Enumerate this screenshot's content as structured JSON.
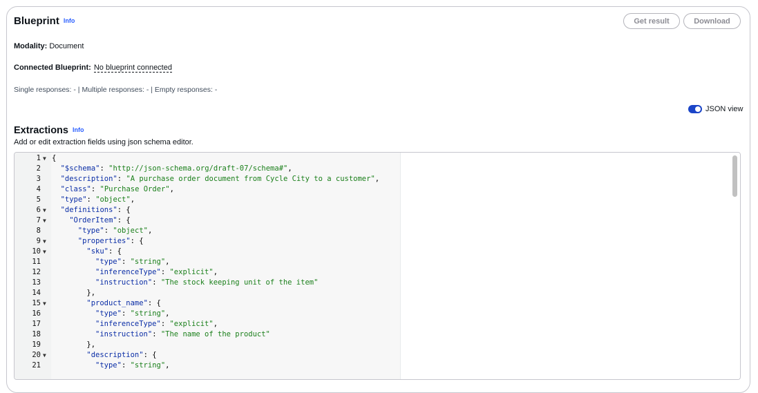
{
  "header": {
    "title": "Blueprint",
    "info_label": "Info",
    "get_result_label": "Get result",
    "download_label": "Download"
  },
  "modality": {
    "label": "Modality:",
    "value": "Document"
  },
  "connected": {
    "label": "Connected Blueprint:",
    "value": "No blueprint connected"
  },
  "responses": {
    "text": "Single responses: - | Multiple responses: - | Empty responses: -"
  },
  "json_toggle": {
    "label": "JSON view",
    "on": true
  },
  "extractions": {
    "title": "Extractions",
    "info_label": "Info",
    "description": "Add or edit extraction fields using json schema editor."
  },
  "colors": {
    "accent": "#1b45c8",
    "key": "#0a2da6",
    "string": "#1a7f1a"
  },
  "editor": {
    "lines": [
      {
        "n": "1",
        "fold": true,
        "indent": 0,
        "tokens": [
          {
            "t": "p",
            "v": "{"
          }
        ]
      },
      {
        "n": "2",
        "fold": false,
        "indent": 1,
        "tokens": [
          {
            "t": "k",
            "v": "\"$schema\""
          },
          {
            "t": "p",
            "v": ": "
          },
          {
            "t": "s",
            "v": "\"http://json-schema.org/draft-07/schema#\""
          },
          {
            "t": "p",
            "v": ","
          }
        ]
      },
      {
        "n": "3",
        "fold": false,
        "indent": 1,
        "tokens": [
          {
            "t": "k",
            "v": "\"description\""
          },
          {
            "t": "p",
            "v": ": "
          },
          {
            "t": "s",
            "v": "\"A purchase order document from Cycle City to a customer\""
          },
          {
            "t": "p",
            "v": ","
          }
        ]
      },
      {
        "n": "4",
        "fold": false,
        "indent": 1,
        "tokens": [
          {
            "t": "k",
            "v": "\"class\""
          },
          {
            "t": "p",
            "v": ": "
          },
          {
            "t": "s",
            "v": "\"Purchase Order\""
          },
          {
            "t": "p",
            "v": ","
          }
        ]
      },
      {
        "n": "5",
        "fold": false,
        "indent": 1,
        "tokens": [
          {
            "t": "k",
            "v": "\"type\""
          },
          {
            "t": "p",
            "v": ": "
          },
          {
            "t": "s",
            "v": "\"object\""
          },
          {
            "t": "p",
            "v": ","
          }
        ]
      },
      {
        "n": "6",
        "fold": true,
        "indent": 1,
        "tokens": [
          {
            "t": "k",
            "v": "\"definitions\""
          },
          {
            "t": "p",
            "v": ": {"
          }
        ]
      },
      {
        "n": "7",
        "fold": true,
        "indent": 2,
        "tokens": [
          {
            "t": "k",
            "v": "\"OrderItem\""
          },
          {
            "t": "p",
            "v": ": {"
          }
        ]
      },
      {
        "n": "8",
        "fold": false,
        "indent": 3,
        "tokens": [
          {
            "t": "k",
            "v": "\"type\""
          },
          {
            "t": "p",
            "v": ": "
          },
          {
            "t": "s",
            "v": "\"object\""
          },
          {
            "t": "p",
            "v": ","
          }
        ]
      },
      {
        "n": "9",
        "fold": true,
        "indent": 3,
        "tokens": [
          {
            "t": "k",
            "v": "\"properties\""
          },
          {
            "t": "p",
            "v": ": {"
          }
        ]
      },
      {
        "n": "10",
        "fold": true,
        "indent": 4,
        "tokens": [
          {
            "t": "k",
            "v": "\"sku\""
          },
          {
            "t": "p",
            "v": ": {"
          }
        ]
      },
      {
        "n": "11",
        "fold": false,
        "indent": 5,
        "tokens": [
          {
            "t": "k",
            "v": "\"type\""
          },
          {
            "t": "p",
            "v": ": "
          },
          {
            "t": "s",
            "v": "\"string\""
          },
          {
            "t": "p",
            "v": ","
          }
        ]
      },
      {
        "n": "12",
        "fold": false,
        "indent": 5,
        "tokens": [
          {
            "t": "k",
            "v": "\"inferenceType\""
          },
          {
            "t": "p",
            "v": ": "
          },
          {
            "t": "s",
            "v": "\"explicit\""
          },
          {
            "t": "p",
            "v": ","
          }
        ]
      },
      {
        "n": "13",
        "fold": false,
        "indent": 5,
        "tokens": [
          {
            "t": "k",
            "v": "\"instruction\""
          },
          {
            "t": "p",
            "v": ": "
          },
          {
            "t": "s",
            "v": "\"The stock keeping unit of the item\""
          }
        ]
      },
      {
        "n": "14",
        "fold": false,
        "indent": 4,
        "tokens": [
          {
            "t": "p",
            "v": "},"
          }
        ]
      },
      {
        "n": "15",
        "fold": true,
        "indent": 4,
        "tokens": [
          {
            "t": "k",
            "v": "\"product_name\""
          },
          {
            "t": "p",
            "v": ": {"
          }
        ]
      },
      {
        "n": "16",
        "fold": false,
        "indent": 5,
        "tokens": [
          {
            "t": "k",
            "v": "\"type\""
          },
          {
            "t": "p",
            "v": ": "
          },
          {
            "t": "s",
            "v": "\"string\""
          },
          {
            "t": "p",
            "v": ","
          }
        ]
      },
      {
        "n": "17",
        "fold": false,
        "indent": 5,
        "tokens": [
          {
            "t": "k",
            "v": "\"inferenceType\""
          },
          {
            "t": "p",
            "v": ": "
          },
          {
            "t": "s",
            "v": "\"explicit\""
          },
          {
            "t": "p",
            "v": ","
          }
        ]
      },
      {
        "n": "18",
        "fold": false,
        "indent": 5,
        "tokens": [
          {
            "t": "k",
            "v": "\"instruction\""
          },
          {
            "t": "p",
            "v": ": "
          },
          {
            "t": "s",
            "v": "\"The name of the product\""
          }
        ]
      },
      {
        "n": "19",
        "fold": false,
        "indent": 4,
        "tokens": [
          {
            "t": "p",
            "v": "},"
          }
        ]
      },
      {
        "n": "20",
        "fold": true,
        "indent": 4,
        "tokens": [
          {
            "t": "k",
            "v": "\"description\""
          },
          {
            "t": "p",
            "v": ": {"
          }
        ]
      },
      {
        "n": "21",
        "fold": false,
        "indent": 5,
        "tokens": [
          {
            "t": "k",
            "v": "\"type\""
          },
          {
            "t": "p",
            "v": ": "
          },
          {
            "t": "s",
            "v": "\"string\""
          },
          {
            "t": "p",
            "v": ","
          }
        ]
      }
    ]
  }
}
